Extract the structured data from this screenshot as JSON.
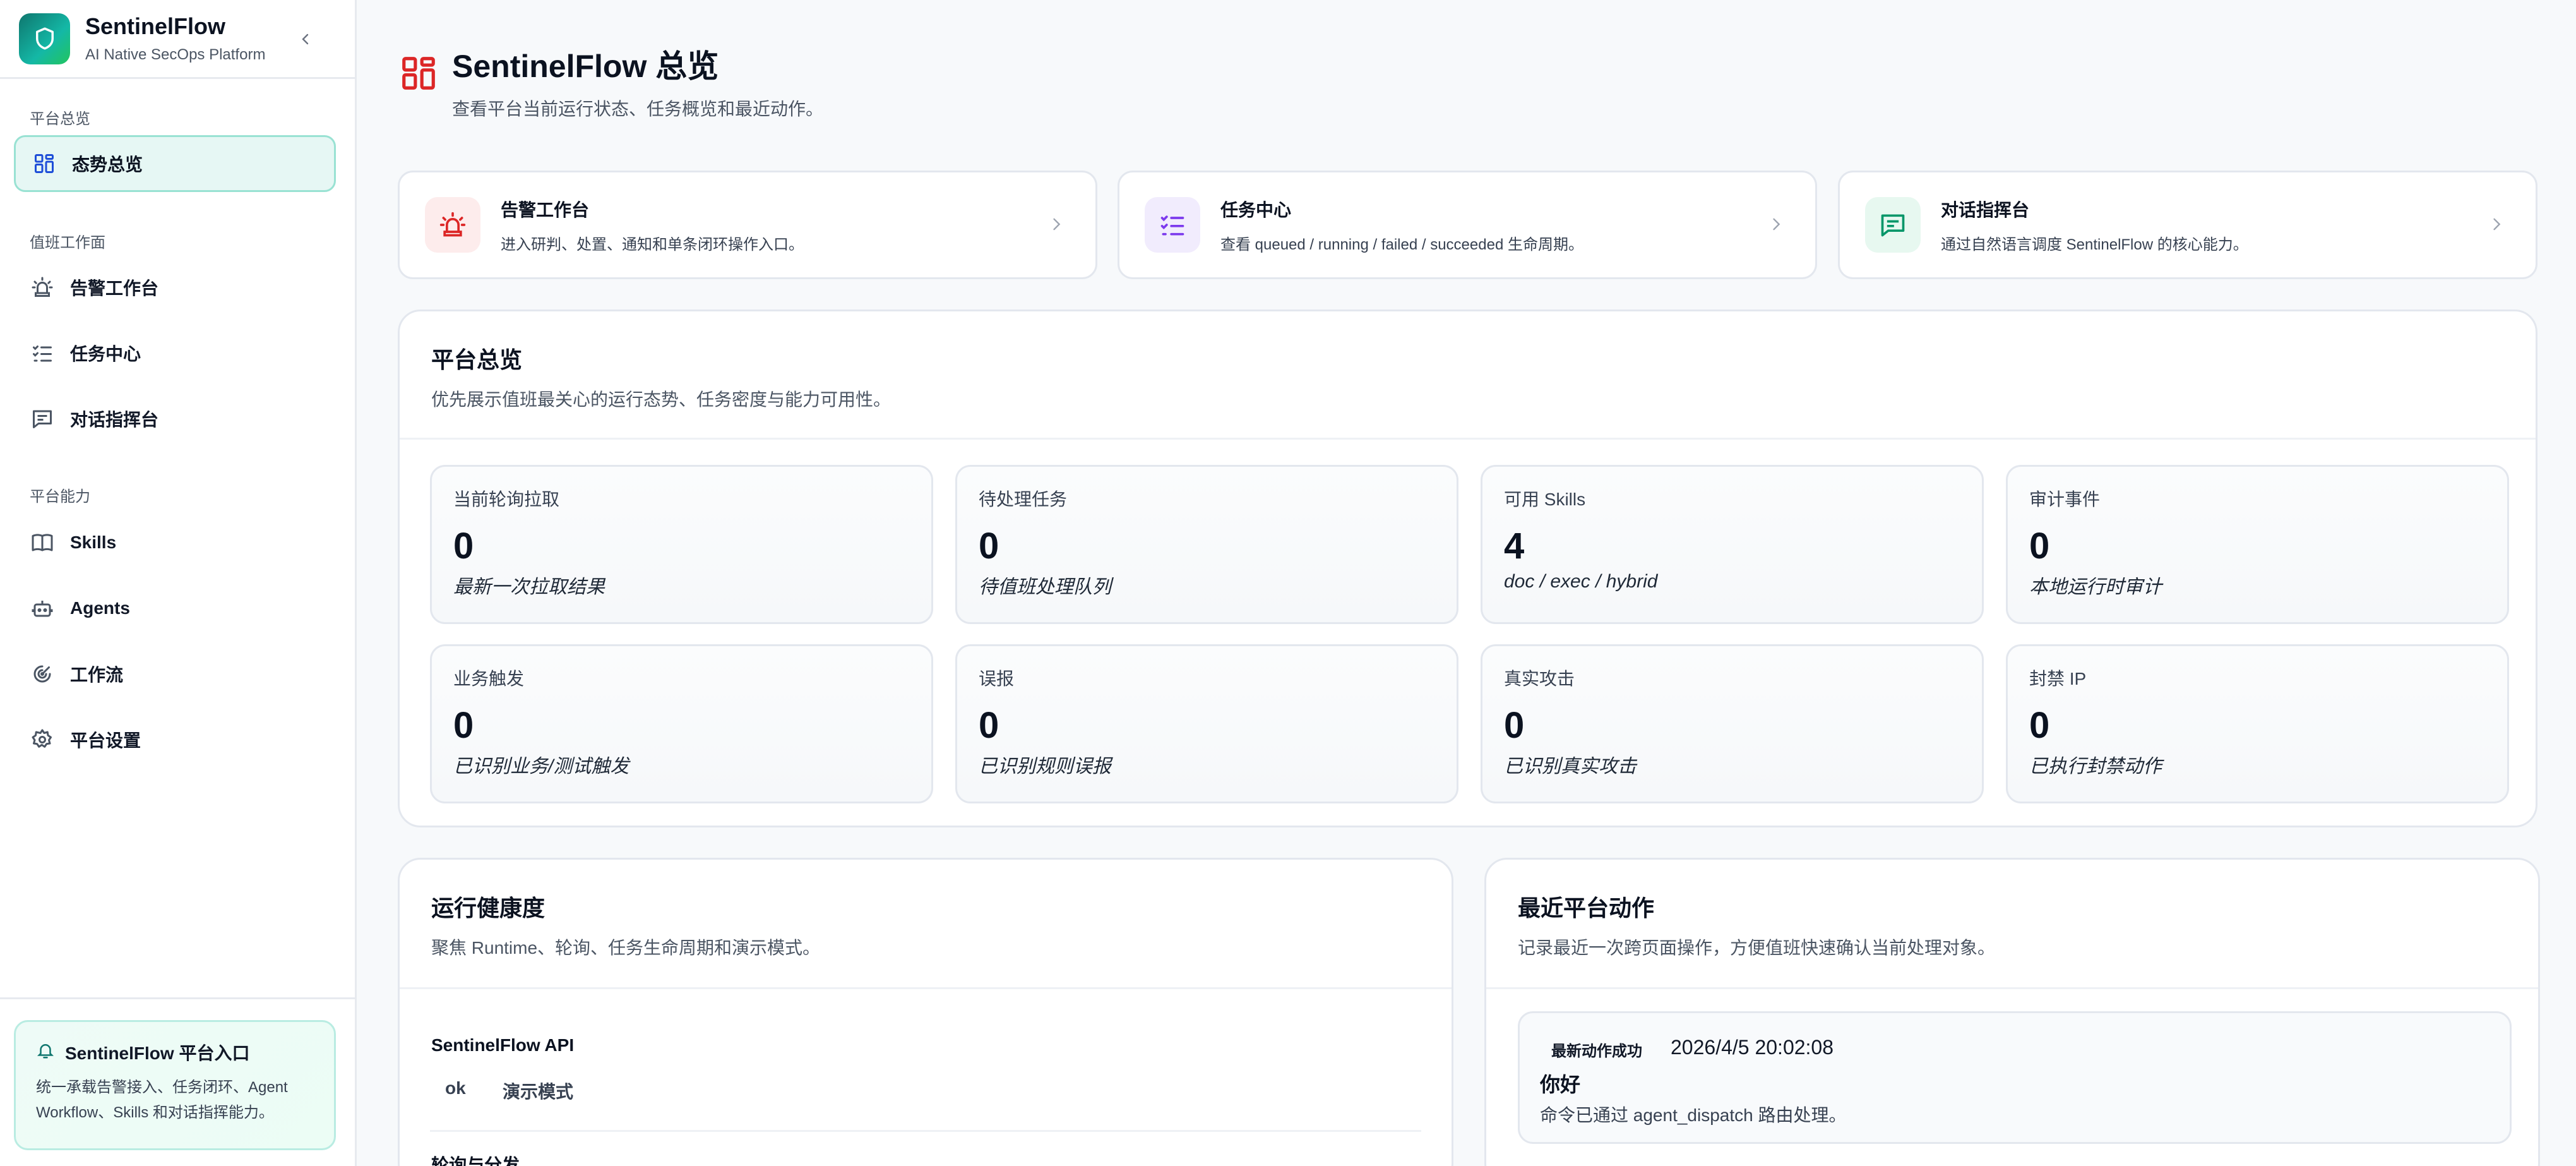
{
  "brand": {
    "title": "SentinelFlow",
    "subtitle": "AI Native SecOps Platform"
  },
  "sidebar": {
    "sections": [
      {
        "title": "平台总览"
      },
      {
        "title": "值班工作面"
      },
      {
        "title": "平台能力"
      }
    ],
    "items": [
      {
        "label": "态势总览",
        "icon": "dashboard-icon",
        "active": true
      },
      {
        "label": "告警工作台",
        "icon": "siren-icon"
      },
      {
        "label": "任务中心",
        "icon": "tasks-icon"
      },
      {
        "label": "对话指挥台",
        "icon": "chat-icon"
      },
      {
        "label": "Skills",
        "icon": "book-icon"
      },
      {
        "label": "Agents",
        "icon": "bot-icon"
      },
      {
        "label": "工作流",
        "icon": "radar-icon"
      },
      {
        "label": "平台设置",
        "icon": "gear-icon"
      }
    ],
    "footer": {
      "title": "SentinelFlow 平台入口",
      "desc_line1": "统一承载告警接入、任务闭环、Agent",
      "desc_line2": "Workflow、Skills 和对话指挥能力。"
    }
  },
  "page": {
    "title": "SentinelFlow 总览",
    "subtitle": "查看平台当前运行状态、任务概览和最近动作。"
  },
  "quick_links": [
    {
      "title": "告警工作台",
      "desc": "进入研判、处置、通知和单条闭环操作入口。",
      "icon": "siren-icon",
      "color": "#dc2626",
      "bg": "#fdecec"
    },
    {
      "title": "任务中心",
      "desc": "查看 queued / running / failed / succeeded 生命周期。",
      "icon": "tasks-icon",
      "color": "#7c3aed",
      "bg": "#f1ecfd"
    },
    {
      "title": "对话指挥台",
      "desc": "通过自然语言调度 SentinelFlow 的核心能力。",
      "icon": "chat-icon",
      "color": "#059669",
      "bg": "#e7f8f0"
    }
  ],
  "overview": {
    "title": "平台总览",
    "subtitle": "优先展示值班最关心的运行态势、任务密度与能力可用性。",
    "metrics": [
      {
        "label": "当前轮询拉取",
        "value": "0",
        "note": "最新一次拉取结果"
      },
      {
        "label": "待处理任务",
        "value": "0",
        "note": "待值班处理队列"
      },
      {
        "label": "可用 Skills",
        "value": "4",
        "note": "doc / exec / hybrid"
      },
      {
        "label": "审计事件",
        "value": "0",
        "note": "本地运行时审计"
      },
      {
        "label": "业务触发",
        "value": "0",
        "note": "已识别业务/测试触发"
      },
      {
        "label": "误报",
        "value": "0",
        "note": "已识别规则误报"
      },
      {
        "label": "真实攻击",
        "value": "0",
        "note": "已识别真实攻击"
      },
      {
        "label": "封禁 IP",
        "value": "0",
        "note": "已执行封禁动作"
      }
    ]
  },
  "health": {
    "title": "运行健康度",
    "subtitle": "聚焦 Runtime、轮询、任务生命周期和演示模式。",
    "api_label": "SentinelFlow API",
    "api_status": "ok",
    "api_mode": "演示模式",
    "next_label": "轮询与分发"
  },
  "recent": {
    "title": "最近平台动作",
    "subtitle": "记录最近一次跨页面操作，方便值班快速确认当前处理对象。",
    "badge": "最新动作成功",
    "time": "2026/4/5 20:02:08",
    "heading": "你好",
    "desc": "命令已通过 agent_dispatch 路由处理。"
  }
}
